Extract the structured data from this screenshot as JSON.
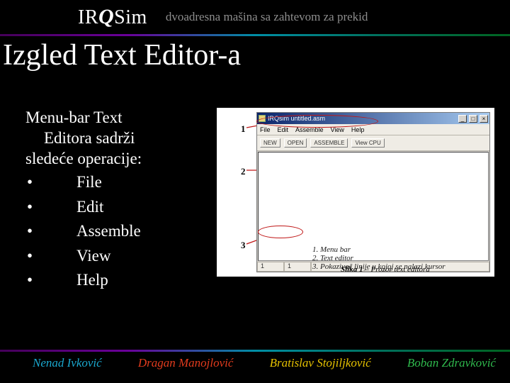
{
  "header": {
    "logo_prefix": "IR",
    "logo_q": "Q",
    "logo_suffix": "Sim",
    "tagline": "dvoadresna mašina sa zahtevom za prekid"
  },
  "title": "Izgled Text Editor-a",
  "body": {
    "paragraph_line1": "Menu-bar Text",
    "paragraph_line2": "Editora sadrži",
    "paragraph_line3": "sledeće operacije:",
    "items": [
      "File",
      "Edit",
      "Assemble",
      "View",
      "Help"
    ]
  },
  "screenshot": {
    "window_title": "IRQsim untitled.asm",
    "menu": [
      "File",
      "Edit",
      "Assemble",
      "View",
      "Help"
    ],
    "toolbar": [
      "NEW",
      "OPEN",
      "ASSEMBLE",
      "View CPU"
    ],
    "status": {
      "line": "1",
      "col": "1"
    },
    "callouts": {
      "n1": "1",
      "n2": "2",
      "n3": "3"
    },
    "captions": [
      "1.   Menu bar",
      "2.   Text editor",
      "3.   Pokazivač linije u kojoj se nalazi kursor"
    ],
    "fig_label_bold": "Slika 1",
    "fig_label_rest": " – Prozor text editora"
  },
  "authors": {
    "a1": "Nenad Ivković",
    "a2": "Dragan Manojlović",
    "a3": "Bratislav Stojiljković",
    "a4": "Boban Zdravković"
  }
}
